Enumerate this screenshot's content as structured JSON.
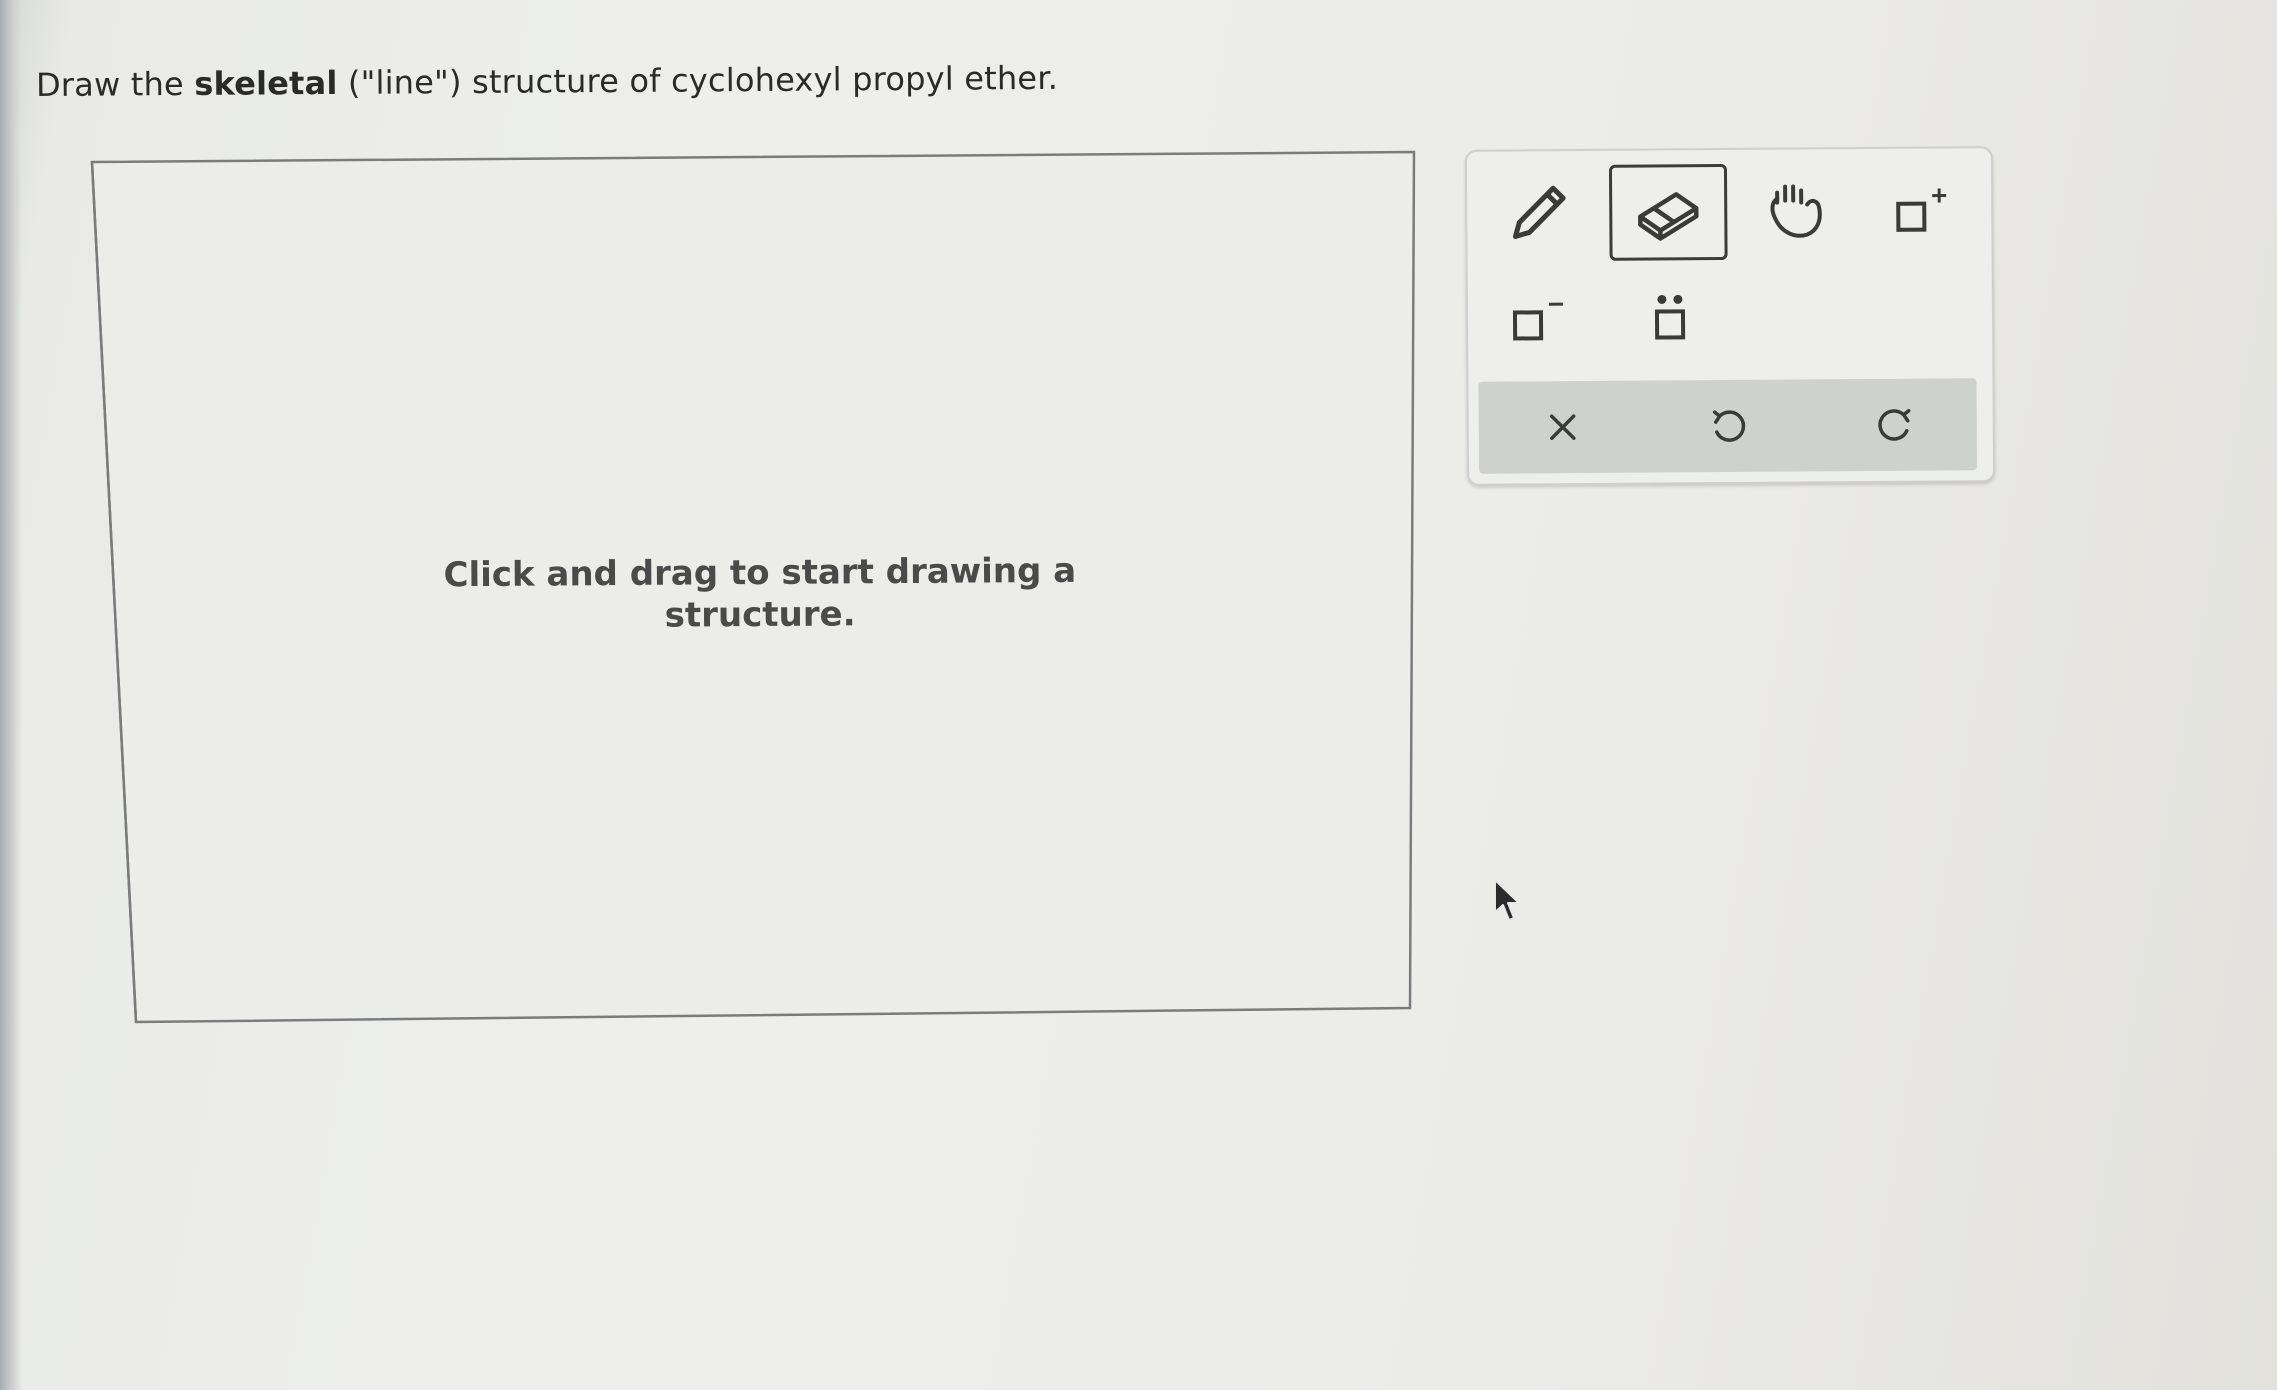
{
  "question": {
    "prefix": "Draw the ",
    "bold": "skeletal",
    "suffix": " (\"line\") structure of cyclohexyl propyl ether."
  },
  "canvas": {
    "hint": "Click and drag to start drawing a structure."
  },
  "toolbar": {
    "tools": [
      {
        "name": "pencil-tool",
        "icon": "pencil-icon"
      },
      {
        "name": "eraser-tool",
        "icon": "eraser-icon",
        "selected": true
      },
      {
        "name": "hand-tool",
        "icon": "hand-icon"
      },
      {
        "name": "add-positive-charge-tool",
        "icon": "positive-charge-icon"
      },
      {
        "name": "add-negative-charge-tool",
        "icon": "negative-charge-icon"
      },
      {
        "name": "add-lone-pair-tool",
        "icon": "lone-pair-icon"
      }
    ],
    "actions": [
      {
        "name": "clear-button",
        "icon": "close-icon"
      },
      {
        "name": "undo-button",
        "icon": "undo-icon"
      },
      {
        "name": "redo-button",
        "icon": "redo-icon"
      }
    ]
  },
  "colors": {
    "text": "#2a2a2a",
    "hint_text": "#4a4a4a",
    "canvas_border": "#7a7c7c",
    "selected_border": "#3b3b3b",
    "action_bar": "#cfd1cf"
  }
}
